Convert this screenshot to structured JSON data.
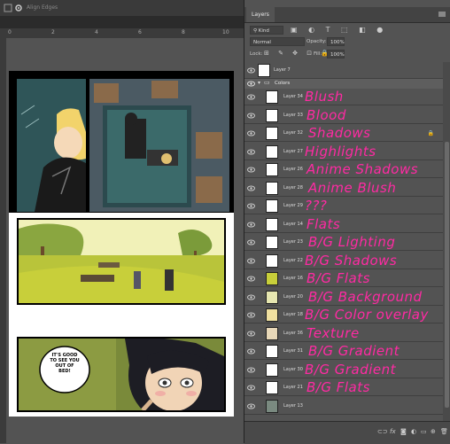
{
  "toolbar": {
    "align_edges_label": "Align Edges"
  },
  "ruler": {
    "ticks": [
      "0",
      "2",
      "4",
      "6",
      "8",
      "10"
    ]
  },
  "comic": {
    "speech_bubble": "IT'S GOOD TO SEE YOU OUT OF BED!"
  },
  "layers_panel": {
    "tab_label": "Layers",
    "filter_kind": "Kind",
    "blend_mode": "Normal",
    "opacity_label": "Opacity:",
    "opacity_value": "100%",
    "lock_label": "Lock:",
    "fill_label": "Fill:",
    "fill_value": "100%",
    "top_layer": "Layer 7",
    "group_name": "Colors",
    "layers": [
      {
        "name": "Layer 34",
        "note": "Blush",
        "locked": false
      },
      {
        "name": "Layer 33",
        "note": "Blood",
        "locked": false
      },
      {
        "name": "Layer 32",
        "note": "Shadows",
        "locked": true
      },
      {
        "name": "Layer 27",
        "note": "Highlights",
        "locked": false
      },
      {
        "name": "Layer 26",
        "note": "Anime Shadows",
        "locked": false
      },
      {
        "name": "Layer 28",
        "note": "Anime Blush",
        "locked": false
      },
      {
        "name": "Layer 29",
        "note": "???",
        "locked": false
      },
      {
        "name": "Layer 14",
        "note": "Flats",
        "locked": false
      },
      {
        "name": "Layer 23",
        "note": "B/G Lighting",
        "locked": false
      },
      {
        "name": "Layer 22",
        "note": "B/G Shadows",
        "locked": false
      },
      {
        "name": "Layer 16",
        "note": "B/G Flats",
        "locked": false
      },
      {
        "name": "Layer 20",
        "note": "B/G Background",
        "locked": false
      },
      {
        "name": "Layer 18",
        "note": "B/G Color overlay",
        "locked": false
      },
      {
        "name": "Layer 36",
        "note": "Texture",
        "locked": false
      },
      {
        "name": "Layer 31",
        "note": "B/G Gradient",
        "locked": false
      },
      {
        "name": "Layer 30",
        "note": "B/G Gradient",
        "locked": false
      },
      {
        "name": "Layer 21",
        "note": "B/G Flats",
        "locked": false
      },
      {
        "name": "Layer 13",
        "note": "",
        "locked": false
      }
    ]
  },
  "colors": {
    "annotation": "#ff2aa3",
    "panel": "#535353"
  }
}
